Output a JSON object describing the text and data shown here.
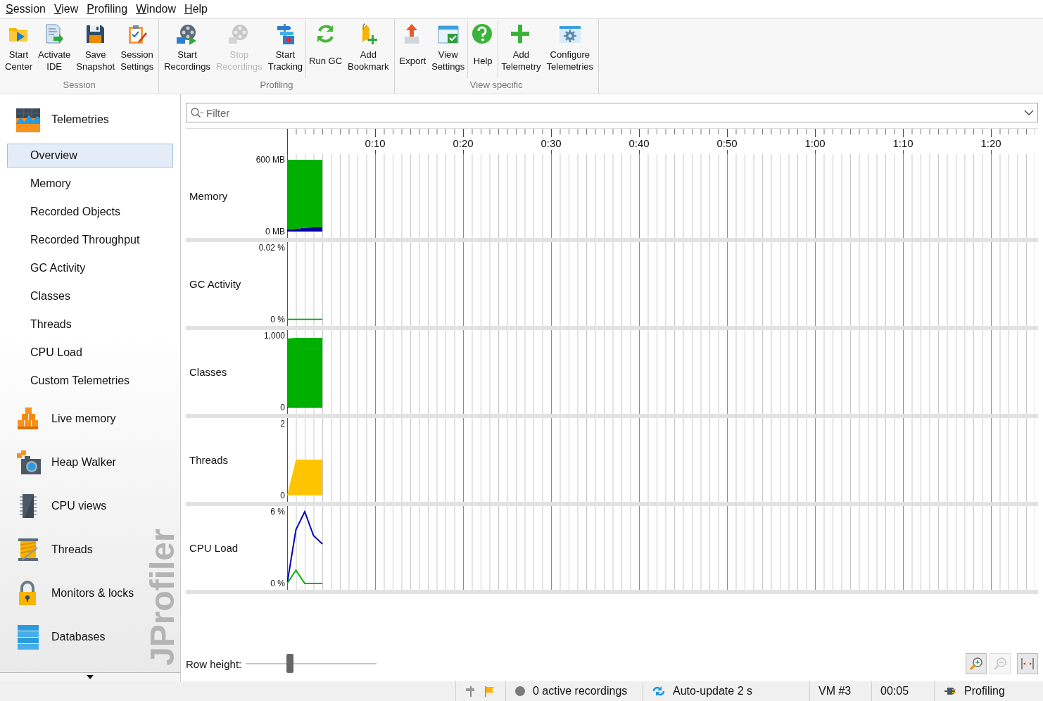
{
  "menu": [
    {
      "label": "Session"
    },
    {
      "label": "View"
    },
    {
      "label": "Profiling"
    },
    {
      "label": "Window"
    },
    {
      "label": "Help"
    }
  ],
  "toolbar": {
    "groups": [
      {
        "label": "Session",
        "sections": [
          {
            "buttons": [
              {
                "label": "Start\nCenter",
                "disabled": false
              },
              {
                "label": "Activate\nIDE",
                "disabled": false
              },
              {
                "label": "Save\nSnapshot",
                "disabled": false
              },
              {
                "label": "Session\nSettings",
                "disabled": false
              }
            ]
          }
        ]
      },
      {
        "label": "Profiling",
        "sections": [
          {
            "buttons": [
              {
                "label": "Start\nRecordings",
                "disabled": false
              },
              {
                "label": "Stop\nRecordings",
                "disabled": true
              },
              {
                "label": "Start\nTracking",
                "disabled": false
              }
            ]
          },
          {
            "buttons": [
              {
                "label": "Run GC",
                "disabled": false
              },
              {
                "label": "Add\nBookmark",
                "disabled": false
              }
            ]
          }
        ]
      },
      {
        "label": "View specific",
        "sections": [
          {
            "buttons": [
              {
                "label": "Export",
                "disabled": false
              },
              {
                "label": "View\nSettings",
                "disabled": false
              }
            ]
          },
          {
            "buttons": [
              {
                "label": "Help",
                "disabled": false
              }
            ]
          },
          {
            "buttons": [
              {
                "label": "Add\nTelemetry",
                "disabled": false
              },
              {
                "label": "Configure\nTelemetries",
                "disabled": false
              }
            ]
          }
        ]
      }
    ]
  },
  "sidebar": {
    "brand_text": "JProfiler",
    "sections": [
      {
        "label": "Telemetries",
        "children": [
          {
            "label": "Overview",
            "selected": true
          },
          {
            "label": "Memory",
            "selected": false
          },
          {
            "label": "Recorded Objects",
            "selected": false
          },
          {
            "label": "Recorded Throughput",
            "selected": false
          },
          {
            "label": "GC Activity",
            "selected": false
          },
          {
            "label": "Classes",
            "selected": false
          },
          {
            "label": "Threads",
            "selected": false
          },
          {
            "label": "CPU Load",
            "selected": false
          },
          {
            "label": "Custom Telemetries",
            "selected": false
          }
        ]
      },
      {
        "label": "Live memory"
      },
      {
        "label": "Heap Walker"
      },
      {
        "label": "CPU views"
      },
      {
        "label": "Threads"
      },
      {
        "label": "Monitors & locks"
      },
      {
        "label": "Databases"
      }
    ]
  },
  "filter": {
    "placeholder": "Filter"
  },
  "telemetries": [
    {
      "chart_data": {
        "type": "area",
        "title": "Memory",
        "stacked": true,
        "grid": true,
        "x": [
          0,
          1,
          2,
          3,
          4
        ],
        "xlim": [
          0,
          85
        ],
        "xticks": [
          {
            "value": 10,
            "label": "0:10"
          },
          {
            "value": 20,
            "label": "0:20"
          },
          {
            "value": 30,
            "label": "0:30"
          },
          {
            "value": 40,
            "label": "0:40"
          },
          {
            "value": 50,
            "label": "0:50"
          },
          {
            "value": 60,
            "label": "1:00"
          },
          {
            "value": 70,
            "label": "1:10"
          },
          {
            "value": 80,
            "label": "1:20"
          }
        ],
        "ylim": [
          -53,
          647
        ],
        "yticks": [
          {
            "value": 0,
            "label": "0 MB"
          },
          {
            "value": 600,
            "label": "600 MB"
          }
        ],
        "series": [
          {
            "color": "#0000a0",
            "values": [
              18,
              22,
              32,
              35,
              38
            ]
          },
          {
            "color": "#00b000",
            "values": [
              582,
              578,
              568,
              565,
              562
            ]
          }
        ]
      }
    },
    {
      "chart_data": {
        "type": "line",
        "title": "GC Activity",
        "grid": true,
        "categories": [
          null,
          null,
          null,
          null,
          null
        ],
        "ylim": [
          -0.0018,
          0.0216
        ],
        "yticks": [
          {
            "value": 0,
            "label": "0 %"
          },
          {
            "value": 0.02,
            "label": "0.02 %"
          }
        ],
        "series": [
          {
            "color": "#00b000",
            "values": [
              0,
              0,
              0,
              0,
              0
            ]
          }
        ]
      }
    },
    {
      "chart_data": {
        "type": "area",
        "title": "Classes",
        "stacked": true,
        "grid": true,
        "categories": [
          null,
          null,
          null,
          null,
          null
        ],
        "ylim": [
          -88,
          1078
        ],
        "yticks": [
          {
            "value": 0,
            "label": "0"
          },
          {
            "value": 1000,
            "label": "1,000"
          }
        ],
        "series": [
          {
            "color": "#0000a0",
            "values": [
              10,
              10,
              10,
              10,
              10
            ]
          },
          {
            "color": "#00b000",
            "values": [
              950,
              960,
              960,
              960,
              960
            ]
          }
        ]
      }
    },
    {
      "chart_data": {
        "type": "area",
        "title": "Threads",
        "grid": true,
        "categories": [
          null,
          null,
          null,
          null,
          null
        ],
        "ylim": [
          -0.18,
          2.16
        ],
        "yticks": [
          {
            "value": 0,
            "label": "0"
          },
          {
            "value": 2,
            "label": "2"
          }
        ],
        "series": [
          {
            "color": "#ffc400",
            "values": [
              0,
              1,
              1,
              1,
              1
            ]
          }
        ]
      }
    },
    {
      "chart_data": {
        "type": "line",
        "title": "CPU Load",
        "grid": true,
        "categories": [
          null,
          null,
          null,
          null,
          null
        ],
        "ylim": [
          -0.53,
          6.47
        ],
        "yticks": [
          {
            "value": 0,
            "label": "0 %"
          },
          {
            "value": 6,
            "label": "6 %"
          }
        ],
        "series": [
          {
            "color": "#0000b0",
            "values": [
              0,
              4.5,
              6,
              4,
              3.3
            ]
          },
          {
            "color": "#00b000",
            "values": [
              0,
              1.1,
              0,
              0,
              0
            ]
          }
        ]
      }
    }
  ],
  "row_height": {
    "label": "Row height:",
    "level": 0.34
  },
  "zoom_controls": [
    {
      "kind": "zoom_in",
      "disabled": false
    },
    {
      "kind": "zoom_out",
      "disabled": true
    },
    {
      "kind": "fit",
      "disabled": false
    }
  ],
  "status_bar": {
    "items": [
      {
        "text": "0 active recordings"
      },
      {
        "text": "Auto-update 2 s"
      },
      {
        "text": "VM #3"
      },
      {
        "text": "00:05"
      },
      {
        "text": "Profiling"
      }
    ]
  }
}
